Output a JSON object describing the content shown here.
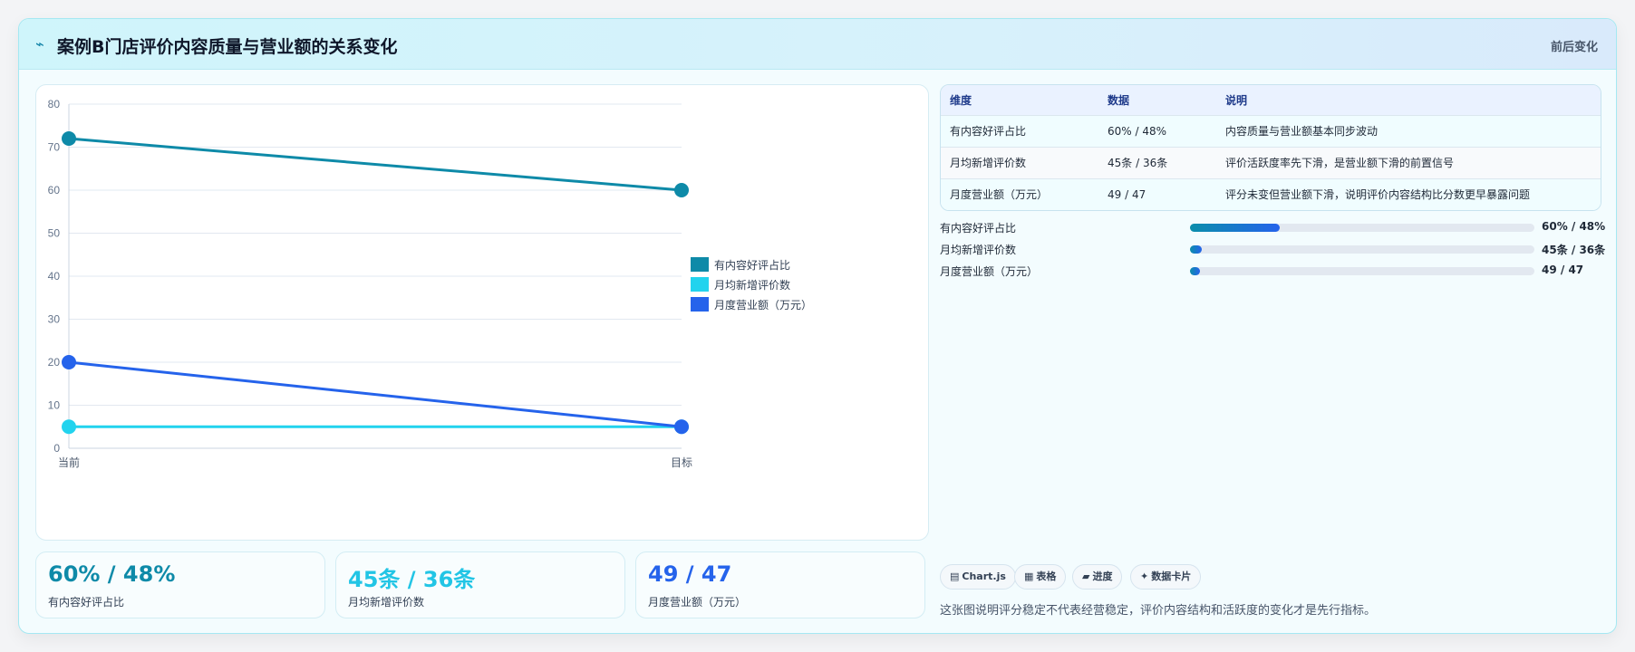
{
  "header": {
    "icon": "chart-line-icon",
    "title": "案例B门店评价内容质量与营业额的关系变化",
    "right_label": "前后变化"
  },
  "chart_data": {
    "type": "line",
    "categories": [
      "当前",
      "目标"
    ],
    "series": [
      {
        "name": "有内容好评占比",
        "values": [
          72,
          60
        ],
        "color": "#0e8aa8"
      },
      {
        "name": "月均新增评价数",
        "values": [
          5,
          5
        ],
        "color": "#22d3ee"
      },
      {
        "name": "月度营业额（万元）",
        "values": [
          20,
          5
        ],
        "color": "#2563eb"
      }
    ],
    "ylim": [
      0,
      80
    ],
    "yticks": [
      0,
      10,
      20,
      30,
      40,
      50,
      60,
      70,
      80
    ],
    "grid": true,
    "legend_position": "right"
  },
  "stats": [
    {
      "value": "60% / 48%",
      "label": "有内容好评占比",
      "color": "#0e8aa8"
    },
    {
      "value": "45条 / 36条",
      "label": "月均新增评价数",
      "color": "#22c5e5"
    },
    {
      "value": "49 / 47",
      "label": "月度营业额（万元）",
      "color": "#2563eb"
    }
  ],
  "table": {
    "headers": [
      "维度",
      "数据",
      "说明"
    ],
    "rows": [
      [
        "有内容好评占比",
        "60% / 48%",
        "内容质量与营业额基本同步波动"
      ],
      [
        "月均新增评价数",
        "45条 / 36条",
        "评价活跃度率先下滑，是营业额下滑的前置信号"
      ],
      [
        "月度营业额（万元）",
        "49 / 47",
        "评分未变但营业额下滑，说明评价内容结构比分数更早暴露问题"
      ]
    ]
  },
  "progress": [
    {
      "label": "有内容好评占比",
      "value": "60% / 48%",
      "fill": 0.26
    },
    {
      "label": "月均新增评价数",
      "value": "45条 / 36条",
      "fill": 0.035
    },
    {
      "label": "月度营业额（万元）",
      "value": "49 / 47",
      "fill": 0.03
    }
  ],
  "tags": [
    {
      "icon": "chart-icon",
      "glyph": "▤",
      "label": "Chart.js"
    },
    {
      "icon": "table-icon",
      "glyph": "▦",
      "label": "表格"
    },
    {
      "icon": "progress-icon",
      "glyph": "▰",
      "label": "进度"
    },
    {
      "icon": "sparkle-icon",
      "glyph": "✦",
      "label": "数据卡片"
    }
  ],
  "footnote": "这张图说明评分稳定不代表经营稳定，评价内容结构和活跃度的变化才是先行指标。"
}
